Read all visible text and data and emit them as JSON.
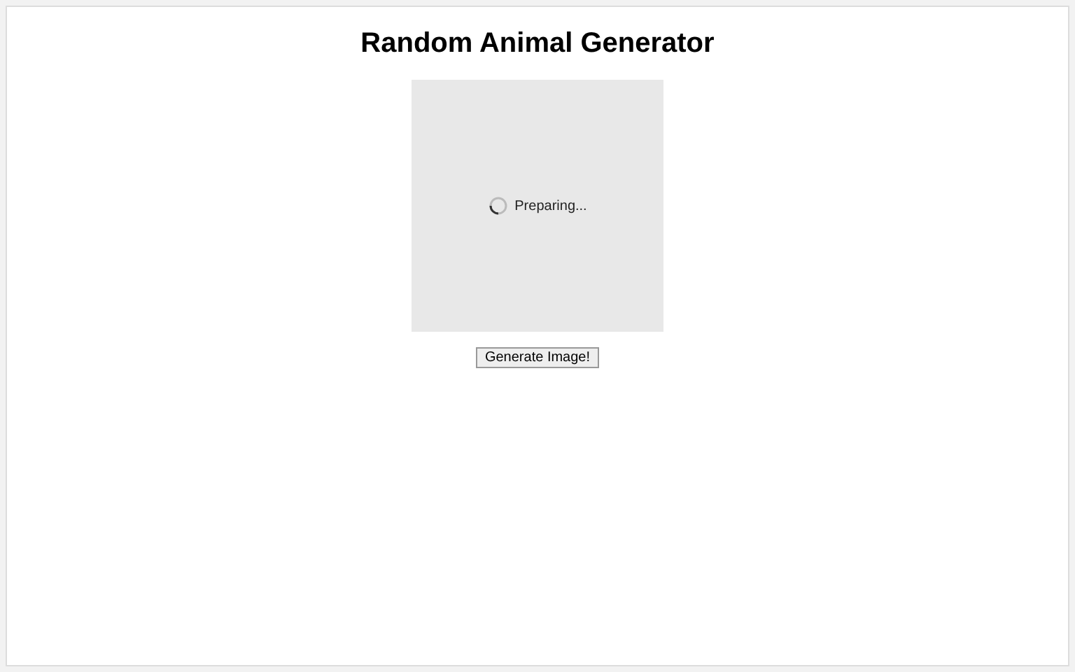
{
  "title": "Random Animal Generator",
  "image_area": {
    "status": "Preparing...",
    "loading": true
  },
  "button": "Generate Image!"
}
